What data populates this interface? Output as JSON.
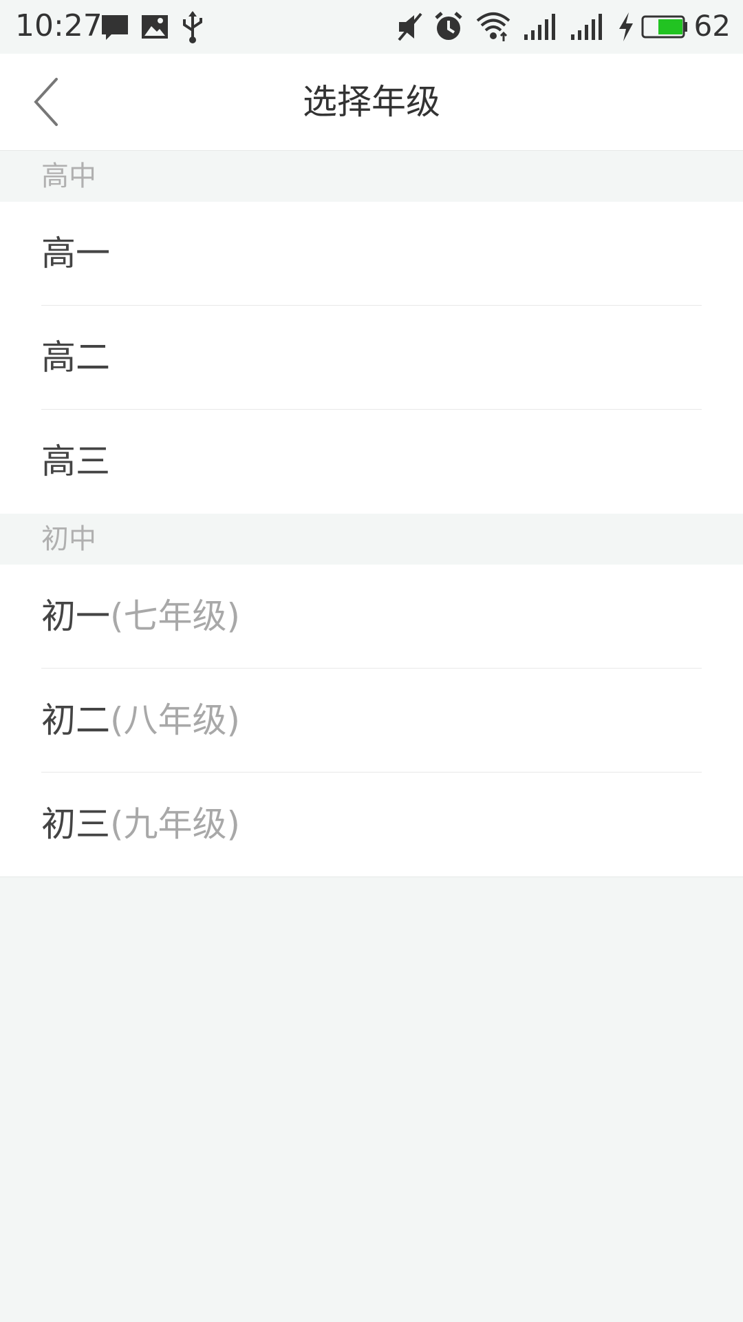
{
  "status_bar": {
    "time": "10:27",
    "icons": [
      "message-icon",
      "image-icon",
      "usb-icon",
      "mute-icon",
      "alarm-icon",
      "wifi-icon",
      "signal-icon",
      "signal-icon",
      "charging-icon",
      "battery-icon"
    ],
    "battery_percent": "62",
    "battery_level": 0.62,
    "battery_color": "#22c322"
  },
  "app_bar": {
    "title": "选择年级",
    "back_icon": "back-chevron-icon"
  },
  "sections": [
    {
      "header": "高中",
      "items": [
        {
          "label": "高一",
          "sub": ""
        },
        {
          "label": "高二",
          "sub": ""
        },
        {
          "label": "高三",
          "sub": ""
        }
      ]
    },
    {
      "header": "初中",
      "items": [
        {
          "label": "初一",
          "sub": "(七年级)"
        },
        {
          "label": "初二",
          "sub": "(八年级)"
        },
        {
          "label": "初三",
          "sub": "(九年级)"
        }
      ]
    }
  ]
}
